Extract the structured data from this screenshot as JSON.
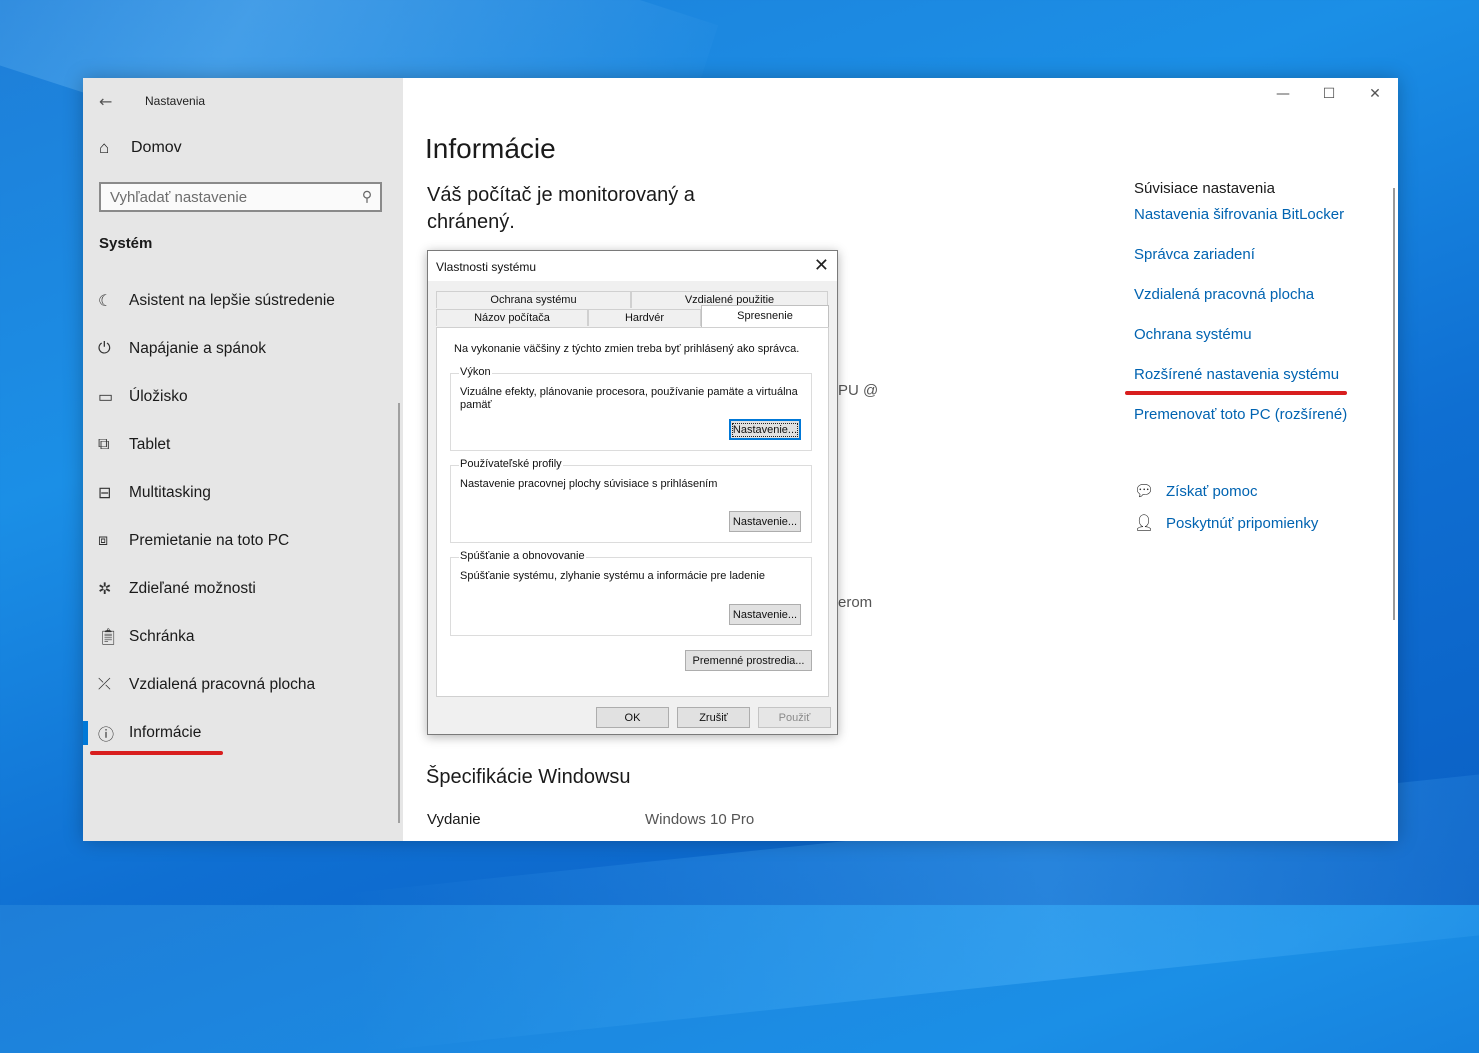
{
  "settings": {
    "title": "Nastavenia",
    "home_label": "Domov",
    "search_placeholder": "Vyhľadať nastavenie",
    "section_title": "Systém",
    "nav": [
      {
        "label": "Asistent na lepšie sústredenie",
        "icon": "moon-icon"
      },
      {
        "label": "Napájanie a spánok",
        "icon": "power-icon"
      },
      {
        "label": "Úložisko",
        "icon": "storage-icon"
      },
      {
        "label": "Tablet",
        "icon": "tablet-icon"
      },
      {
        "label": "Multitasking",
        "icon": "multitasking-icon"
      },
      {
        "label": "Premietanie na toto PC",
        "icon": "projection-icon"
      },
      {
        "label": "Zdieľané možnosti",
        "icon": "shared-icon"
      },
      {
        "label": "Schránka",
        "icon": "clipboard-icon"
      },
      {
        "label": "Vzdialená pracovná plocha",
        "icon": "remote-desktop-icon"
      },
      {
        "label": "Informácie",
        "icon": "info-icon"
      }
    ],
    "active_nav_index": 9,
    "accent_color": "#0078d7",
    "annotation_color": "#d81e1e"
  },
  "main": {
    "title": "Informácie",
    "protection_text": "Váš počítač je monitorovaný a chránený.",
    "partial_text_1": "PU @",
    "partial_text_2": "erom",
    "specs_title": "Špecifikácie Windowsu",
    "specs": [
      {
        "key": "Vydanie",
        "value": "Windows 10 Pro"
      }
    ]
  },
  "related": {
    "title": "Súvisiace nastavenia",
    "links": [
      "Nastavenia šifrovania BitLocker",
      "Správca zariadení",
      "Vzdialená pracovná plocha",
      "Ochrana systému",
      "Rozšírené nastavenia systému",
      "Premenovať toto PC (rozšírené)"
    ],
    "help": [
      {
        "label": "Získať pomoc",
        "icon": "help-chat-icon"
      },
      {
        "label": "Poskytnúť pripomienky",
        "icon": "feedback-icon"
      }
    ]
  },
  "dialog": {
    "title": "Vlastnosti systému",
    "tabs_row1": [
      "Ochrana systému",
      "Vzdialené použitie"
    ],
    "tabs_row2": [
      "Názov počítača",
      "Hardvér",
      "Spresnenie"
    ],
    "selected_tab": "Spresnenie",
    "note": "Na vykonanie väčšiny z týchto zmien treba byť prihlásený ako správca.",
    "groups": [
      {
        "legend": "Výkon",
        "description": "Vizuálne efekty, plánovanie procesora, používanie pamäte a virtuálna pamäť",
        "button": "Nastavenie..."
      },
      {
        "legend": "Používateľské profily",
        "description": "Nastavenie pracovnej plochy súvisiace s prihlásením",
        "button": "Nastavenie..."
      },
      {
        "legend": "Spúšťanie a obnovovanie",
        "description": "Spúšťanie systému, zlyhanie systému a informácie pre ladenie",
        "button": "Nastavenie..."
      }
    ],
    "env_button": "Premenné prostredia...",
    "ok": "OK",
    "cancel": "Zrušiť",
    "apply": "Použiť"
  }
}
